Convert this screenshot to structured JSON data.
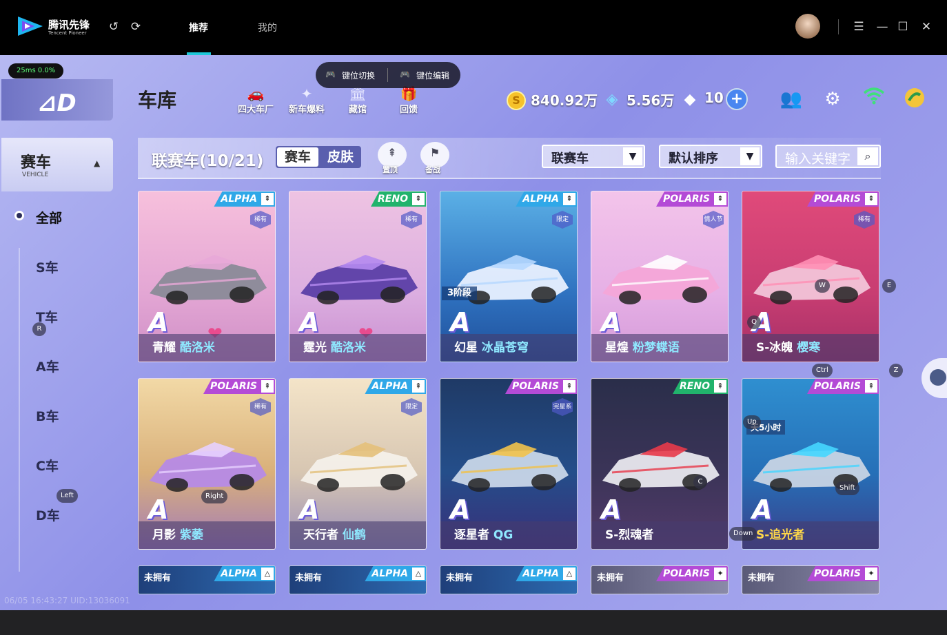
{
  "app": {
    "name": "腾讯先锋",
    "subtitle": "Tencent Pioneer"
  },
  "tabs": [
    {
      "label": "推荐",
      "active": true
    },
    {
      "label": "我的",
      "active": false
    }
  ],
  "status": {
    "latency": "25ms",
    "loss": "0.0%"
  },
  "keybar": {
    "switch_label": "键位切换",
    "edit_label": "键位编辑"
  },
  "sidebar": {
    "category": {
      "label": "赛车",
      "sub": "VEHICLE"
    },
    "items": [
      {
        "label": "全部",
        "selected": true
      },
      {
        "label": "S车"
      },
      {
        "label": "T车"
      },
      {
        "label": "A车"
      },
      {
        "label": "B车"
      },
      {
        "label": "C车"
      },
      {
        "label": "D车"
      }
    ]
  },
  "header": {
    "title": "车库",
    "nav": [
      {
        "label": "四大车厂",
        "icon": "car-factory-icon"
      },
      {
        "label": "新车爆料",
        "icon": "new-badge-icon"
      },
      {
        "label": "藏馆",
        "icon": "museum-icon"
      },
      {
        "label": "回馈",
        "icon": "gift-box-icon"
      }
    ],
    "currency": {
      "coins": "840.92万",
      "voucher": "5.56万",
      "diamonds": "10"
    }
  },
  "filter": {
    "title": "联赛车(10/21)",
    "seg_vehicle": "赛车",
    "seg_skin": "皮肤",
    "pin_top": "置顶",
    "prepare": "备战",
    "dropdown_type": "联赛车",
    "dropdown_sort": "默认排序",
    "search_placeholder": "输入关键字"
  },
  "cars": [
    {
      "brand": "ALPHA",
      "brand_class": "alpha",
      "badge": "稀有",
      "name": "青耀",
      "skin": "酷洛米",
      "heart": true,
      "grad": "linear-gradient(180deg,#f7c0dc 0%,#e3a6d4 60%,#cf8fc6 100%)",
      "body": "#8a8a98",
      "accent": "#e8a8d8"
    },
    {
      "brand": "RENO",
      "brand_class": "reno",
      "badge": "稀有",
      "name": "霆光",
      "skin": "酷洛米",
      "heart": true,
      "grad": "linear-gradient(180deg,#eec3e2 0%,#dcaee0 60%,#c98fd0 100%)",
      "body": "#5b3fa6",
      "accent": "#b58af0"
    },
    {
      "brand": "ALPHA",
      "brand_class": "alpha",
      "badge": "限定",
      "name": "幻星",
      "skin": "冰晶苍穹",
      "stage": "3阶段",
      "grad": "linear-gradient(180deg,#5bb0e6 0%,#2f72c0 60%,#1f4f9a 100%)",
      "body": "#e8f0ff",
      "accent": "#b6d8ff"
    },
    {
      "brand": "POLARIS",
      "brand_class": "polaris",
      "badge": "情人节",
      "name": "星煌",
      "skin": "粉梦蝶语",
      "grad": "linear-gradient(180deg,#f3c4ea 0%,#e6b0e6 60%,#d49ad8 100%)",
      "body": "#f4a6d8",
      "accent": "#ffffff"
    },
    {
      "brand": "POLARIS",
      "brand_class": "polaris",
      "badge": "稀有",
      "name": "S-冰魄",
      "skin": "樱寒",
      "grad": "linear-gradient(180deg,#e04a7a 0%,#c83d72 60%,#a53066 100%)",
      "body": "#f2c4d8",
      "accent": "#ff8fb5"
    },
    {
      "brand": "POLARIS",
      "brand_class": "polaris",
      "badge": "稀有",
      "name": "月影",
      "skin": "紫萎",
      "grad": "linear-gradient(180deg,#f2d9a6 0%,#d9b07a 55%,#a37bb8 100%)",
      "body": "#b68ae6",
      "accent": "#e7d0ff"
    },
    {
      "brand": "ALPHA",
      "brand_class": "alpha",
      "badge": "限定",
      "name": "天行者",
      "skin": "仙鹤",
      "grad": "linear-gradient(180deg,#f4e4c8 0%,#d7c6b2 55%,#9a8fb8 100%)",
      "body": "#f4f0ea",
      "accent": "#e4c07a"
    },
    {
      "brand": "POLARIS",
      "brand_class": "polaris",
      "badge": "完星系列",
      "name": "逐星者",
      "skin": "QG",
      "grad": "linear-gradient(180deg,#1f3a66 0%,#244e8a 55%,#3a2f7a 100%)",
      "body": "#c8d6e8",
      "accent": "#f2c24a"
    },
    {
      "brand": "RENO",
      "brand_class": "reno",
      "name": "S-烈魂者",
      "grad": "linear-gradient(180deg,#2a2e4a 0%,#3b3458 55%,#533a6a 100%)",
      "body": "#e8e8ee",
      "accent": "#e83a4a"
    },
    {
      "brand": "POLARIS",
      "brand_class": "polaris",
      "name": "S-追光者",
      "limit": "天5小时",
      "gold": true,
      "grad": "linear-gradient(180deg,#2f8fd0 0%,#2670b8 55%,#3a3f8a 100%)",
      "body": "#c7d4e4",
      "accent": "#45d6ff"
    }
  ],
  "bottom_cards": [
    {
      "owned": "未拥有",
      "brand": "ALPHA",
      "brand_class": "alpha"
    },
    {
      "owned": "未拥有",
      "brand": "ALPHA",
      "brand_class": "alpha"
    },
    {
      "owned": "未拥有",
      "brand": "ALPHA",
      "brand_class": "alpha"
    },
    {
      "owned": "未拥有",
      "brand": "POLARIS",
      "brand_class": "polaris"
    },
    {
      "owned": "未拥有",
      "brand": "POLARIS",
      "brand_class": "polaris"
    }
  ],
  "key_hints": {
    "R": "R",
    "W": "W",
    "E": "E",
    "Q": "Q",
    "Ctrl": "Ctrl",
    "Z": "Z",
    "Up": "Up",
    "Right": "Right",
    "Left": "Left",
    "C": "C",
    "Shift": "Shift",
    "Down": "Down"
  },
  "watermark": "06/05 16:43:27 UID:13036091"
}
